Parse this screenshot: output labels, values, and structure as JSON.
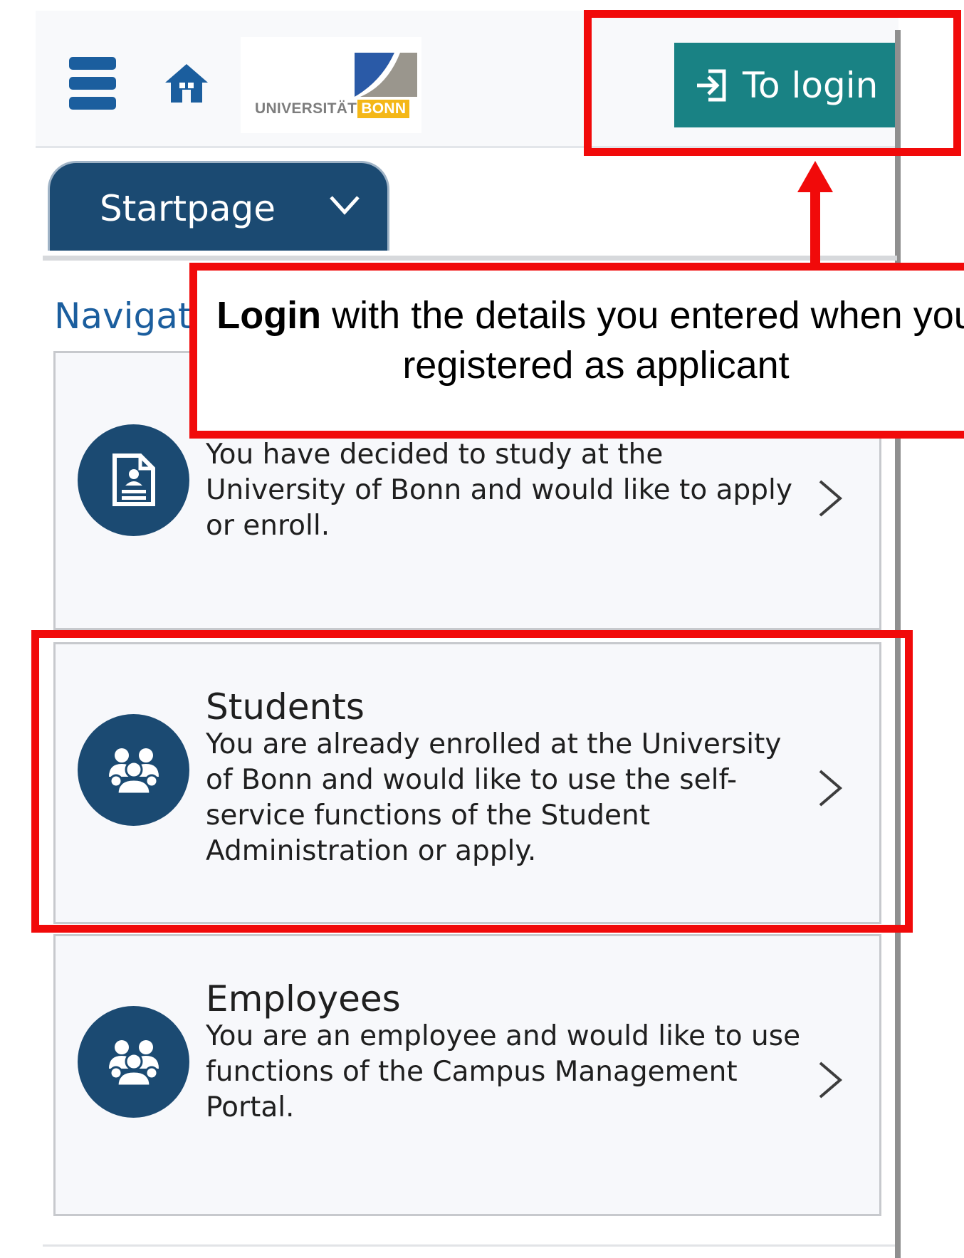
{
  "header": {
    "logo_text_main": "UNIVERSITÄT",
    "logo_text_accent": "BONN",
    "login_label": "To login"
  },
  "tab": {
    "label": "Startpage"
  },
  "navigation": {
    "heading": "Navigati"
  },
  "cards": [
    {
      "title": "",
      "description_lines": [
        "You have decided to study at the",
        "University of Bonn and would like to apply",
        "or enroll."
      ]
    },
    {
      "title": "Students",
      "description_lines": [
        "You are already enrolled at the University",
        "of Bonn and would like to use the self-",
        "service functions of the Student",
        "Administration or apply."
      ]
    },
    {
      "title": "Employees",
      "description_lines": [
        "You are an employee and would like to use",
        "functions of the Campus Management",
        "Portal."
      ]
    }
  ],
  "annotation": {
    "bold_word": "Login",
    "rest_line_1": " with the details you entered when you",
    "line_2": "registered as applicant"
  },
  "colors": {
    "primary_dark_blue": "#1b4a72",
    "link_blue": "#1b5e9e",
    "login_teal": "#198284",
    "annotation_red": "#f10a0a",
    "logo_yellow": "#f4b717"
  },
  "icons": {
    "menu": "hamburger-menu-icon",
    "home": "home-icon",
    "login": "login-icon",
    "dropdown": "chevron-down-icon",
    "card_1": "document-icon",
    "card_2": "group-icon",
    "card_3": "group-icon",
    "card_arrow": "chevron-right-icon"
  }
}
